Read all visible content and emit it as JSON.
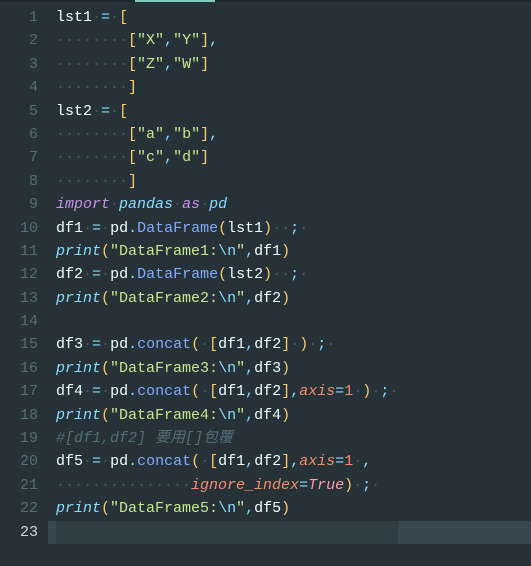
{
  "editor": {
    "line_count": 23,
    "current_line": 23,
    "lines": {
      "l1": {
        "prefix": "",
        "tokens": [
          {
            "c": "id",
            "t": "lst1"
          },
          {
            "c": "ws",
            "t": " "
          },
          {
            "c": "op",
            "t": "="
          },
          {
            "c": "ws",
            "t": " "
          },
          {
            "c": "brk",
            "t": "["
          }
        ]
      },
      "l2": {
        "prefix": "        ",
        "tokens": [
          {
            "c": "brk",
            "t": "["
          },
          {
            "c": "str",
            "t": "\"X\""
          },
          {
            "c": "pun",
            "t": ","
          },
          {
            "c": "str",
            "t": "\"Y\""
          },
          {
            "c": "brk",
            "t": "]"
          },
          {
            "c": "pun",
            "t": ","
          }
        ]
      },
      "l3": {
        "prefix": "        ",
        "tokens": [
          {
            "c": "brk",
            "t": "["
          },
          {
            "c": "str",
            "t": "\"Z\""
          },
          {
            "c": "pun",
            "t": ","
          },
          {
            "c": "str",
            "t": "\"W\""
          },
          {
            "c": "brk",
            "t": "]"
          }
        ]
      },
      "l4": {
        "prefix": "        ",
        "tokens": [
          {
            "c": "brk",
            "t": "]"
          }
        ]
      },
      "l5": {
        "prefix": "",
        "tokens": [
          {
            "c": "id",
            "t": "lst2"
          },
          {
            "c": "ws",
            "t": " "
          },
          {
            "c": "op",
            "t": "="
          },
          {
            "c": "ws",
            "t": " "
          },
          {
            "c": "brk",
            "t": "["
          }
        ]
      },
      "l6": {
        "prefix": "        ",
        "tokens": [
          {
            "c": "brk",
            "t": "["
          },
          {
            "c": "str",
            "t": "\"a\""
          },
          {
            "c": "pun",
            "t": ","
          },
          {
            "c": "str",
            "t": "\"b\""
          },
          {
            "c": "brk",
            "t": "]"
          },
          {
            "c": "pun",
            "t": ","
          }
        ]
      },
      "l7": {
        "prefix": "        ",
        "tokens": [
          {
            "c": "brk",
            "t": "["
          },
          {
            "c": "str",
            "t": "\"c\""
          },
          {
            "c": "pun",
            "t": ","
          },
          {
            "c": "str",
            "t": "\"d\""
          },
          {
            "c": "brk",
            "t": "]"
          }
        ]
      },
      "l8": {
        "prefix": "        ",
        "tokens": [
          {
            "c": "brk",
            "t": "]"
          }
        ]
      },
      "l9": {
        "prefix": "",
        "tokens": [
          {
            "c": "kw",
            "t": "import"
          },
          {
            "c": "ws",
            "t": " "
          },
          {
            "c": "mod",
            "t": "pandas"
          },
          {
            "c": "ws",
            "t": " "
          },
          {
            "c": "kw",
            "t": "as"
          },
          {
            "c": "ws",
            "t": " "
          },
          {
            "c": "mod",
            "t": "pd"
          }
        ]
      },
      "l10": {
        "prefix": "",
        "tokens": [
          {
            "c": "id",
            "t": "df1"
          },
          {
            "c": "ws",
            "t": " "
          },
          {
            "c": "op",
            "t": "="
          },
          {
            "c": "ws",
            "t": " "
          },
          {
            "c": "id",
            "t": "pd"
          },
          {
            "c": "pun",
            "t": "."
          },
          {
            "c": "fn",
            "t": "DataFrame"
          },
          {
            "c": "brk",
            "t": "("
          },
          {
            "c": "id",
            "t": "lst1"
          },
          {
            "c": "brk",
            "t": ")"
          },
          {
            "c": "ws",
            "t": "  "
          },
          {
            "c": "pun",
            "t": ";"
          },
          {
            "c": "ws",
            "t": " "
          }
        ]
      },
      "l11": {
        "prefix": "",
        "tokens": [
          {
            "c": "fnbi",
            "t": "print"
          },
          {
            "c": "brk",
            "t": "("
          },
          {
            "c": "str",
            "t": "\"DataFrame1:"
          },
          {
            "c": "esc",
            "t": "\\n"
          },
          {
            "c": "str",
            "t": "\""
          },
          {
            "c": "pun",
            "t": ","
          },
          {
            "c": "id",
            "t": "df1"
          },
          {
            "c": "brk",
            "t": ")"
          }
        ]
      },
      "l12": {
        "prefix": "",
        "tokens": [
          {
            "c": "id",
            "t": "df2"
          },
          {
            "c": "ws",
            "t": " "
          },
          {
            "c": "op",
            "t": "="
          },
          {
            "c": "ws",
            "t": " "
          },
          {
            "c": "id",
            "t": "pd"
          },
          {
            "c": "pun",
            "t": "."
          },
          {
            "c": "fn",
            "t": "DataFrame"
          },
          {
            "c": "brk",
            "t": "("
          },
          {
            "c": "id",
            "t": "lst2"
          },
          {
            "c": "brk",
            "t": ")"
          },
          {
            "c": "ws",
            "t": "  "
          },
          {
            "c": "pun",
            "t": ";"
          },
          {
            "c": "ws",
            "t": " "
          }
        ]
      },
      "l13": {
        "prefix": "",
        "tokens": [
          {
            "c": "fnbi",
            "t": "print"
          },
          {
            "c": "brk",
            "t": "("
          },
          {
            "c": "str",
            "t": "\"DataFrame2:"
          },
          {
            "c": "esc",
            "t": "\\n"
          },
          {
            "c": "str",
            "t": "\""
          },
          {
            "c": "pun",
            "t": ","
          },
          {
            "c": "id",
            "t": "df2"
          },
          {
            "c": "brk",
            "t": ")"
          }
        ]
      },
      "l14": {
        "prefix": "",
        "tokens": []
      },
      "l15": {
        "prefix": "",
        "tokens": [
          {
            "c": "id",
            "t": "df3"
          },
          {
            "c": "ws",
            "t": " "
          },
          {
            "c": "op",
            "t": "="
          },
          {
            "c": "ws",
            "t": " "
          },
          {
            "c": "id",
            "t": "pd"
          },
          {
            "c": "pun",
            "t": "."
          },
          {
            "c": "fn",
            "t": "concat"
          },
          {
            "c": "brk",
            "t": "("
          },
          {
            "c": "ws",
            "t": " "
          },
          {
            "c": "brk",
            "t": "["
          },
          {
            "c": "id",
            "t": "df1"
          },
          {
            "c": "pun",
            "t": ","
          },
          {
            "c": "id",
            "t": "df2"
          },
          {
            "c": "brk",
            "t": "]"
          },
          {
            "c": "ws",
            "t": " "
          },
          {
            "c": "brk",
            "t": ")"
          },
          {
            "c": "ws",
            "t": " "
          },
          {
            "c": "pun",
            "t": ";"
          },
          {
            "c": "ws",
            "t": " "
          }
        ]
      },
      "l16": {
        "prefix": "",
        "tokens": [
          {
            "c": "fnbi",
            "t": "print"
          },
          {
            "c": "brk",
            "t": "("
          },
          {
            "c": "str",
            "t": "\"DataFrame3:"
          },
          {
            "c": "esc",
            "t": "\\n"
          },
          {
            "c": "str",
            "t": "\""
          },
          {
            "c": "pun",
            "t": ","
          },
          {
            "c": "id",
            "t": "df3"
          },
          {
            "c": "brk",
            "t": ")"
          }
        ]
      },
      "l17": {
        "prefix": "",
        "tokens": [
          {
            "c": "id",
            "t": "df4"
          },
          {
            "c": "ws",
            "t": " "
          },
          {
            "c": "op",
            "t": "="
          },
          {
            "c": "ws",
            "t": " "
          },
          {
            "c": "id",
            "t": "pd"
          },
          {
            "c": "pun",
            "t": "."
          },
          {
            "c": "fn",
            "t": "concat"
          },
          {
            "c": "brk",
            "t": "("
          },
          {
            "c": "ws",
            "t": " "
          },
          {
            "c": "brk",
            "t": "["
          },
          {
            "c": "id",
            "t": "df1"
          },
          {
            "c": "pun",
            "t": ","
          },
          {
            "c": "id",
            "t": "df2"
          },
          {
            "c": "brk",
            "t": "]"
          },
          {
            "c": "pun",
            "t": ","
          },
          {
            "c": "kwarg",
            "t": "axis"
          },
          {
            "c": "op",
            "t": "="
          },
          {
            "c": "num2",
            "t": "1"
          },
          {
            "c": "ws",
            "t": " "
          },
          {
            "c": "brk",
            "t": ")"
          },
          {
            "c": "ws",
            "t": " "
          },
          {
            "c": "pun",
            "t": ";"
          },
          {
            "c": "ws",
            "t": " "
          }
        ]
      },
      "l18": {
        "prefix": "",
        "tokens": [
          {
            "c": "fnbi",
            "t": "print"
          },
          {
            "c": "brk",
            "t": "("
          },
          {
            "c": "str",
            "t": "\"DataFrame4:"
          },
          {
            "c": "esc",
            "t": "\\n"
          },
          {
            "c": "str",
            "t": "\""
          },
          {
            "c": "pun",
            "t": ","
          },
          {
            "c": "id",
            "t": "df4"
          },
          {
            "c": "brk",
            "t": ")"
          }
        ]
      },
      "l19": {
        "prefix": "",
        "tokens": [
          {
            "c": "com",
            "t": "#[df1,df2] 要用[]包覆"
          }
        ]
      },
      "l20": {
        "prefix": "",
        "tokens": [
          {
            "c": "id",
            "t": "df5"
          },
          {
            "c": "ws",
            "t": " "
          },
          {
            "c": "op",
            "t": "="
          },
          {
            "c": "ws",
            "t": " "
          },
          {
            "c": "id",
            "t": "pd"
          },
          {
            "c": "pun",
            "t": "."
          },
          {
            "c": "fn",
            "t": "concat"
          },
          {
            "c": "brk",
            "t": "("
          },
          {
            "c": "ws",
            "t": " "
          },
          {
            "c": "brk",
            "t": "["
          },
          {
            "c": "id",
            "t": "df1"
          },
          {
            "c": "pun",
            "t": ","
          },
          {
            "c": "id",
            "t": "df2"
          },
          {
            "c": "brk",
            "t": "]"
          },
          {
            "c": "pun",
            "t": ","
          },
          {
            "c": "kwarg",
            "t": "axis"
          },
          {
            "c": "op",
            "t": "="
          },
          {
            "c": "num2",
            "t": "1"
          },
          {
            "c": "ws",
            "t": " "
          },
          {
            "c": "pun",
            "t": ","
          }
        ]
      },
      "l21": {
        "prefix": "               ",
        "tokens": [
          {
            "c": "kwarg",
            "t": "ignore_index"
          },
          {
            "c": "op",
            "t": "="
          },
          {
            "c": "bool",
            "t": "True"
          },
          {
            "c": "brk",
            "t": ")"
          },
          {
            "c": "ws",
            "t": " "
          },
          {
            "c": "pun",
            "t": ";"
          },
          {
            "c": "ws",
            "t": " "
          }
        ]
      },
      "l22": {
        "prefix": "",
        "tokens": [
          {
            "c": "fnbi",
            "t": "print"
          },
          {
            "c": "brk",
            "t": "("
          },
          {
            "c": "str",
            "t": "\"DataFrame5:"
          },
          {
            "c": "esc",
            "t": "\\n"
          },
          {
            "c": "str",
            "t": "\""
          },
          {
            "c": "pun",
            "t": ","
          },
          {
            "c": "id",
            "t": "df5"
          },
          {
            "c": "brk",
            "t": ")"
          }
        ]
      },
      "l23": {
        "prefix": "",
        "tokens": []
      }
    }
  }
}
